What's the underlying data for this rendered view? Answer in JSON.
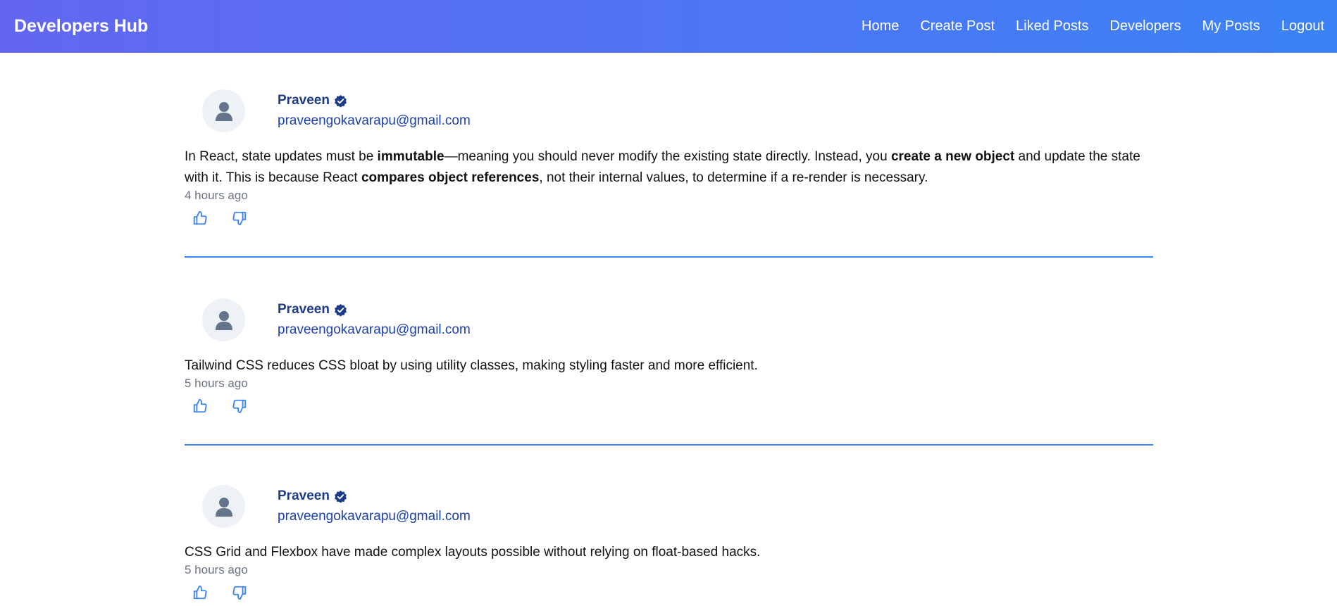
{
  "navbar": {
    "brand": "Developers Hub",
    "links": [
      "Home",
      "Create Post",
      "Liked Posts",
      "Developers",
      "My Posts",
      "Logout"
    ],
    "gradient_from": "#6366f1",
    "gradient_to": "#3b82f6"
  },
  "posts": [
    {
      "author": "Praveen",
      "email": "praveengokavarapu@gmail.com",
      "content_parts": [
        {
          "text": "In React, state updates must be ",
          "bold": false
        },
        {
          "text": "immutable",
          "bold": true
        },
        {
          "text": "—meaning you should never modify the existing state directly. Instead, you ",
          "bold": false
        },
        {
          "text": "create a new object",
          "bold": true
        },
        {
          "text": " and update the state with it. This is because React ",
          "bold": false
        },
        {
          "text": "compares object references",
          "bold": true
        },
        {
          "text": ", not their internal values, to determine if a re-render is necessary.",
          "bold": false
        }
      ],
      "time": "4 hours ago"
    },
    {
      "author": "Praveen",
      "email": "praveengokavarapu@gmail.com",
      "content": "Tailwind CSS reduces CSS bloat by using utility classes, making styling faster and more efficient.",
      "time": "5 hours ago"
    },
    {
      "author": "Praveen",
      "email": "praveengokavarapu@gmail.com",
      "content": "CSS Grid and Flexbox have made complex layouts possible without relying on float-based hacks.",
      "time": "5 hours ago"
    }
  ],
  "icons": {
    "verified": "verified-badge-icon",
    "avatar": "user-avatar-icon",
    "like": "thumbs-up-icon",
    "dislike": "thumbs-down-icon"
  },
  "colors": {
    "author": "#1e3a8a",
    "divider": "#3b82f6",
    "reaction_icon": "#3b82f6",
    "avatar_bg": "#eef1f6"
  }
}
